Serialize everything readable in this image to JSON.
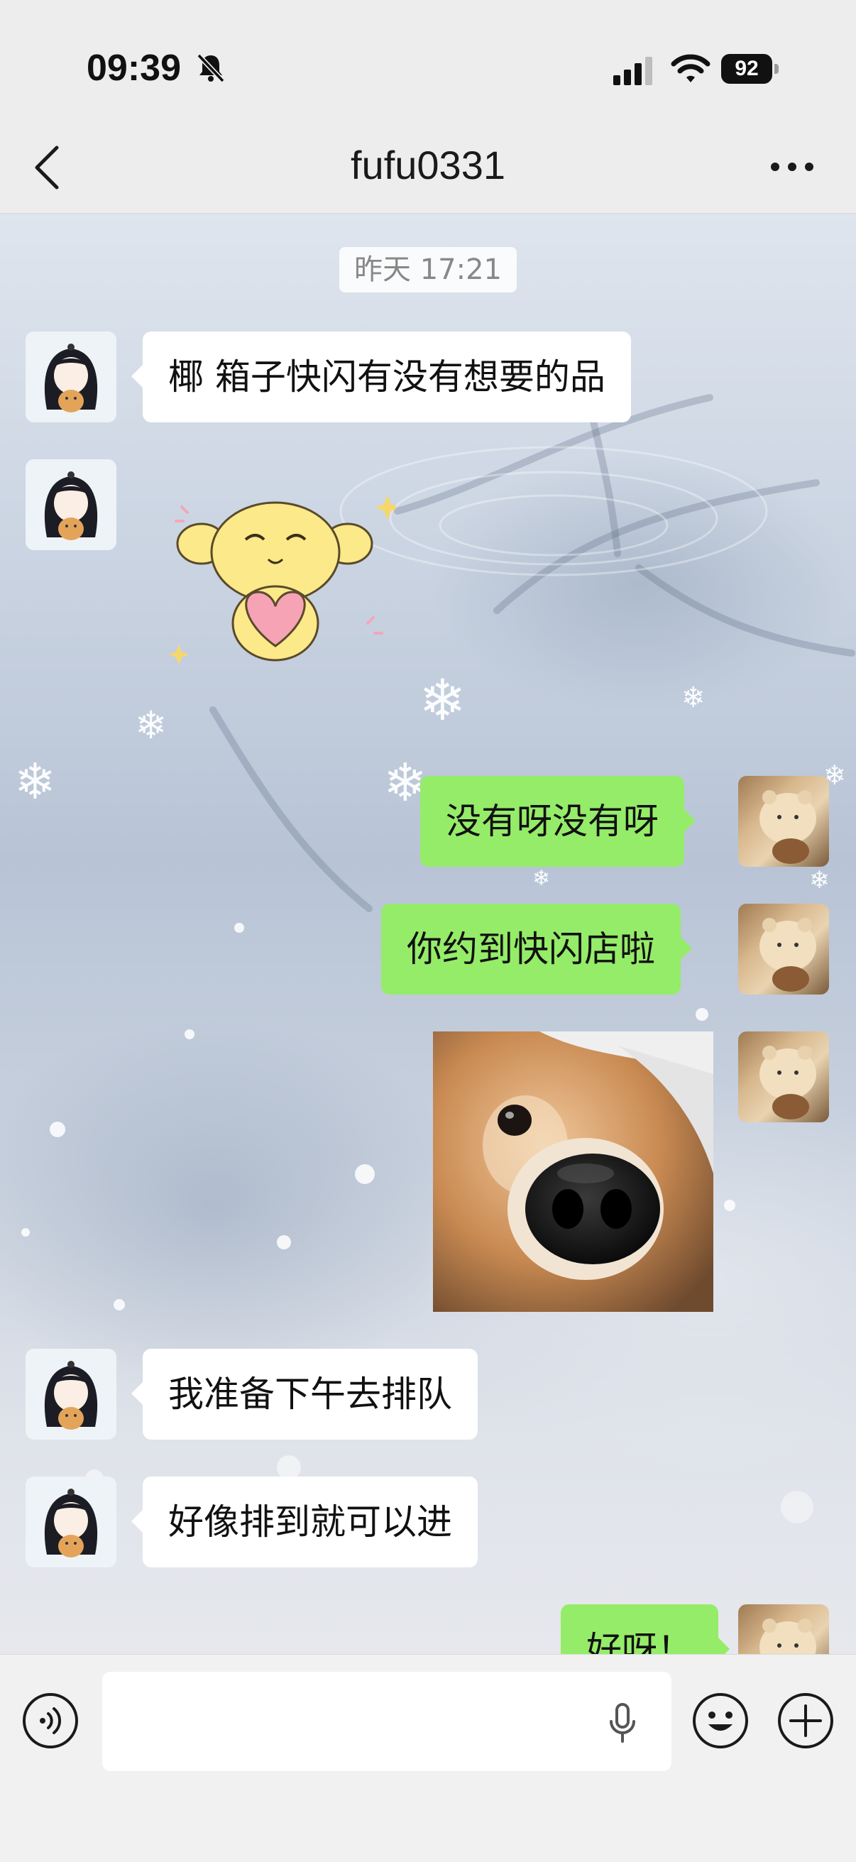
{
  "status_bar": {
    "time": "09:39",
    "battery": "92"
  },
  "nav": {
    "title": "fufu0331"
  },
  "timestamp": "昨天 17:21",
  "messages": [
    {
      "side": "in",
      "type": "text",
      "text": "椰 箱子快闪有没有想要的品"
    },
    {
      "side": "in",
      "type": "sticker",
      "sticker": "yellow-puppy-holding-heart"
    },
    {
      "side": "out",
      "type": "text",
      "text": "没有呀没有呀"
    },
    {
      "side": "out",
      "type": "text",
      "text": "你约到快闪店啦"
    },
    {
      "side": "out",
      "type": "image",
      "image": "shiba-dog-nose-closeup"
    },
    {
      "side": "in",
      "type": "text",
      "text": "我准备下午去排队"
    },
    {
      "side": "in",
      "type": "text",
      "text": "好像排到就可以进"
    },
    {
      "side": "out",
      "type": "text",
      "text": "好呀！"
    }
  ],
  "input_bar": {
    "placeholder": ""
  },
  "colors": {
    "bubble_out": "#95ec69",
    "bubble_in": "#ffffff",
    "bar_bg": "#ededed"
  },
  "icons": [
    "bell-slash-icon",
    "signal-icon",
    "wifi-icon",
    "battery-icon",
    "back-icon",
    "more-icon",
    "voice-icon",
    "mic-icon",
    "emoji-icon",
    "plus-icon"
  ]
}
